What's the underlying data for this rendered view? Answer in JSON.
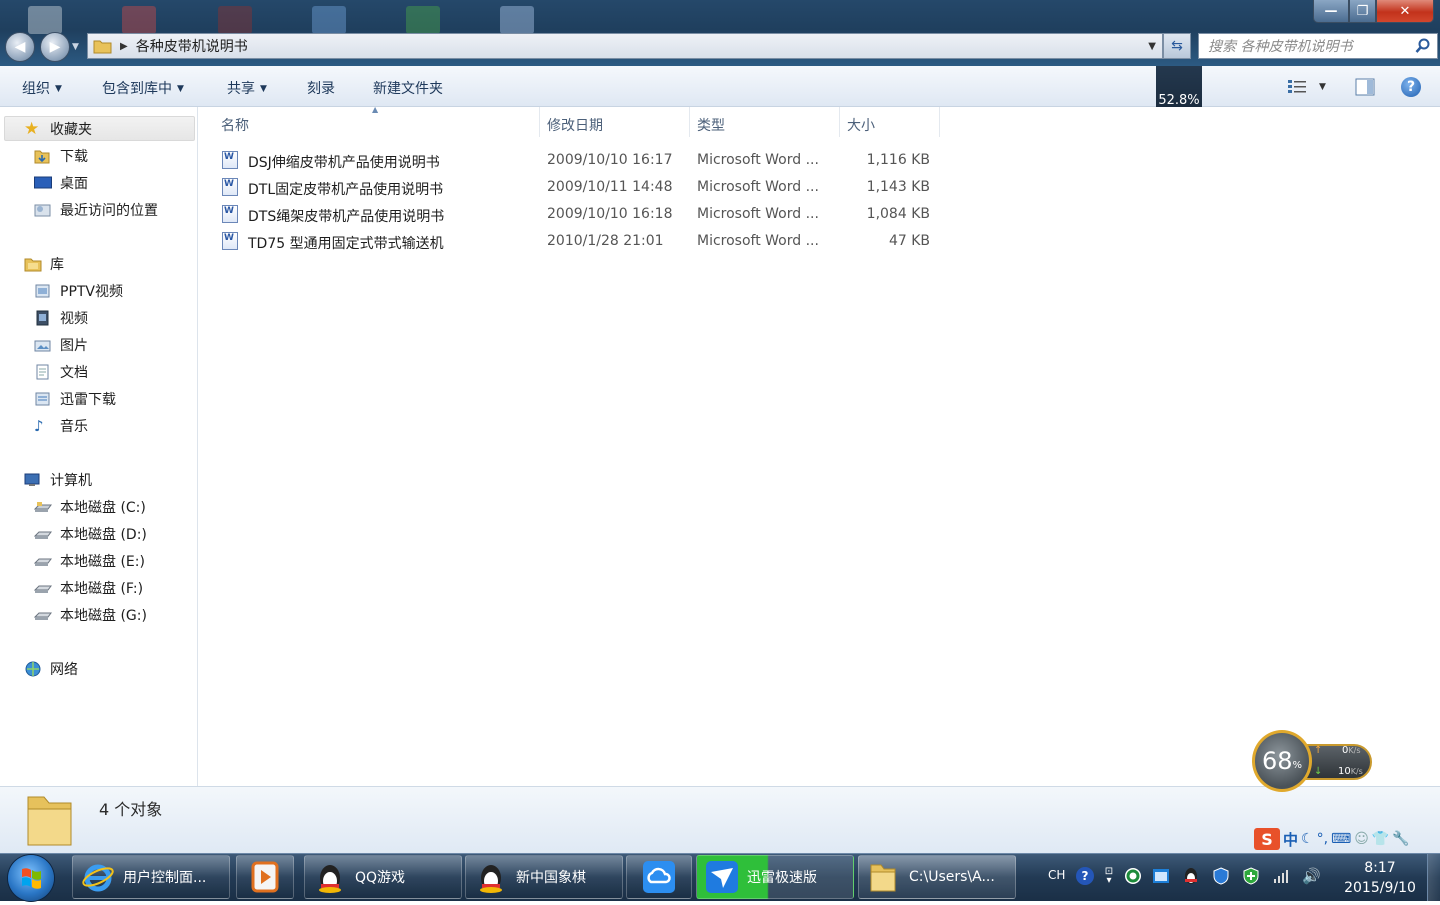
{
  "window": {
    "controls": {
      "minimize": "—",
      "maximize": "❐",
      "close": "✕"
    },
    "address": {
      "crumb": "各种皮带机说明书"
    },
    "search": {
      "placeholder": "搜索 各种皮带机说明书"
    }
  },
  "toolbar": {
    "organize": "组织",
    "include_in_library": "包含到库中",
    "share": "共享",
    "burn": "刻录",
    "new_folder": "新建文件夹",
    "usage_tooltip": "52.8%"
  },
  "nav": {
    "favorites": {
      "label": "收藏夹",
      "items": [
        "下载",
        "桌面",
        "最近访问的位置"
      ]
    },
    "libraries": {
      "label": "库",
      "items": [
        "PPTV视频",
        "视频",
        "图片",
        "文档",
        "迅雷下载",
        "音乐"
      ]
    },
    "computer": {
      "label": "计算机",
      "items": [
        "本地磁盘 (C:)",
        "本地磁盘 (D:)",
        "本地磁盘 (E:)",
        "本地磁盘 (F:)",
        "本地磁盘 (G:)"
      ]
    },
    "network": {
      "label": "网络"
    }
  },
  "file_list": {
    "columns": [
      "名称",
      "修改日期",
      "类型",
      "大小"
    ],
    "rows": [
      {
        "name": "DSJ伸缩皮带机产品使用说明书",
        "date": "2009/10/10 16:17",
        "type": "Microsoft Word ...",
        "size": "1,116 KB"
      },
      {
        "name": "DTL固定皮带机产品使用说明书",
        "date": "2009/10/11 14:48",
        "type": "Microsoft Word ...",
        "size": "1,143 KB"
      },
      {
        "name": "DTS绳架皮带机产品使用说明书",
        "date": "2009/10/10 16:18",
        "type": "Microsoft Word ...",
        "size": "1,084 KB"
      },
      {
        "name": "TD75 型通用固定式带式输送机",
        "date": "2010/1/28 21:01",
        "type": "Microsoft Word ...",
        "size": "47 KB"
      }
    ]
  },
  "details": {
    "count_text": "4 个对象"
  },
  "widget": {
    "percent": "68",
    "percent_sign": "%",
    "upload": "0",
    "download": "10",
    "unit": "K/s"
  },
  "ime": {
    "lang": "中"
  },
  "taskbar": {
    "buttons": [
      {
        "label": "用户控制面..."
      },
      {
        "label": ""
      },
      {
        "label": "QQ游戏"
      },
      {
        "label": "新中国象棋"
      },
      {
        "label": ""
      },
      {
        "label": "迅雷极速版"
      },
      {
        "label": "C:\\Users\\A..."
      }
    ],
    "tray_lang": "CH",
    "time": "8:17",
    "date": "2015/9/10"
  },
  "colors": {
    "accent": "#1e395b",
    "link_text": "#4c607a",
    "taskbar_active": "#2fbf3a"
  }
}
